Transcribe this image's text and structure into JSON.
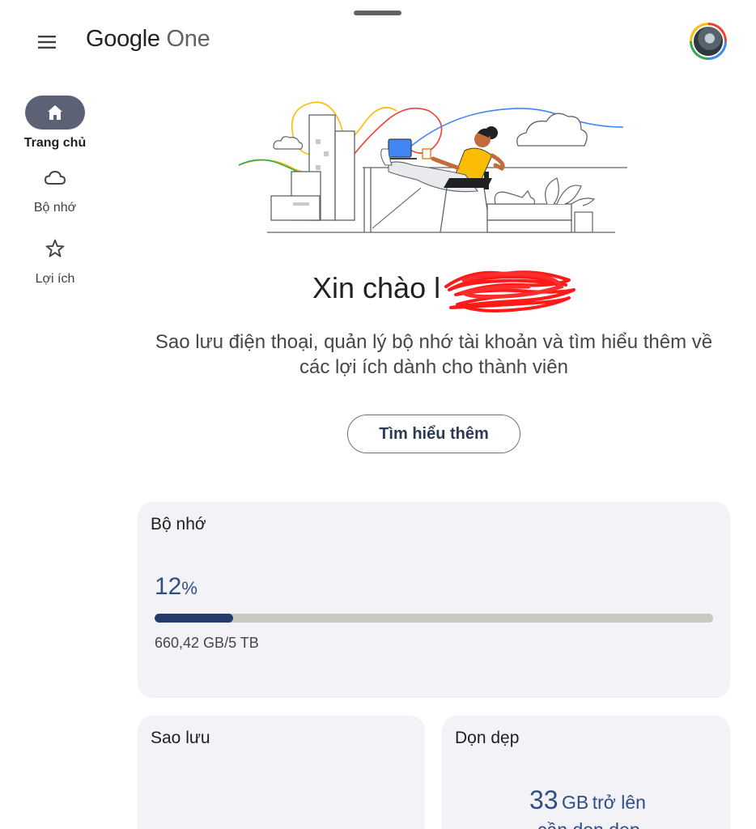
{
  "app": {
    "brand_main": "Google",
    "brand_sub": "One"
  },
  "nav": {
    "items": [
      {
        "label": "Trang chủ",
        "icon": "home-icon",
        "active": true
      },
      {
        "label": "Bộ nhớ",
        "icon": "cloud-icon",
        "active": false
      },
      {
        "label": "Lợi ích",
        "icon": "star-icon",
        "active": false
      }
    ]
  },
  "hero": {
    "greeting": "Xin chào l",
    "subtitle": "Sao lưu điện thoại, quản lý bộ nhớ tài khoản và tìm hiểu thêm về các lợi ích dành cho thành viên",
    "button_label": "Tìm hiểu thêm"
  },
  "storage": {
    "title": "Bộ nhớ",
    "percent": "12",
    "percent_symbol": "%",
    "used_fraction": 0.14,
    "usage_text": "660,42 GB/5 TB"
  },
  "backup": {
    "title": "Sao lưu"
  },
  "cleanup": {
    "title": "Dọn dẹp",
    "amount": "33",
    "unit": "GB",
    "suffix": "trở lên",
    "subtext": "cần dọn dẹp"
  },
  "colors": {
    "accent": "#2e4f86",
    "bar_fill": "#243b6b",
    "bar_track": "#c9c9c0",
    "nav_active": "#5d6175",
    "card_bg": "#f3f2f7"
  }
}
